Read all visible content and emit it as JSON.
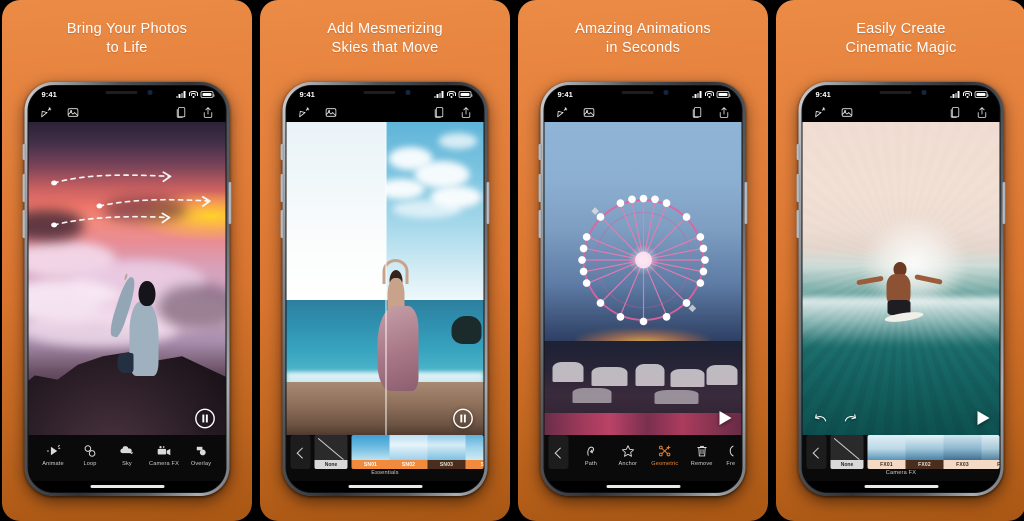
{
  "theme": {
    "background_top": "#eb8b45",
    "background_bottom": "#a95714",
    "accent": "#e8873a",
    "preset_label_bg": "#f08a3c",
    "selected_label_bg": "#4a2d1c"
  },
  "status_bar": {
    "time": "9:41",
    "icons": [
      "signal-icon",
      "wifi-icon",
      "battery-icon"
    ]
  },
  "app_toolbar": {
    "left_icons": [
      {
        "name": "magic-wand-icon"
      },
      {
        "name": "photo-library-icon"
      }
    ],
    "right_icons": [
      {
        "name": "layers-icon"
      },
      {
        "name": "share-icon"
      }
    ]
  },
  "panels": [
    {
      "id": "panel-1",
      "headline": {
        "line1": "Bring Your Photos",
        "line2": "to Life"
      },
      "canvas": {
        "photo_description": "person sitting on rock above pink sunset clouds",
        "overlay": "animation-path-arrows",
        "playback_icon": "pause-icon"
      },
      "bottom_bar_type": "tools",
      "tools": [
        {
          "label": "Animate",
          "icon": "animate-icon",
          "active": false
        },
        {
          "label": "Loop",
          "icon": "loop-icon",
          "active": false
        },
        {
          "label": "Sky",
          "icon": "sky-icon",
          "active": false
        },
        {
          "label": "Camera FX",
          "icon": "camera-fx-icon",
          "active": false
        },
        {
          "label": "Overlay",
          "icon": "overlay-icon",
          "active": false
        }
      ]
    },
    {
      "id": "panel-2",
      "headline": {
        "line1": "Add Mesmerizing",
        "line2": "Skies that Move"
      },
      "canvas": {
        "photo_description": "woman on coastal rock, before/after sky split",
        "overlay": "split-compare-divider",
        "playback_icon": "pause-icon"
      },
      "bottom_bar_type": "presets",
      "presets": {
        "back_icon": "chevron-left-icon",
        "none_label": "None",
        "category": "Essentials",
        "items": [
          {
            "label": "SN01",
            "selected": false
          },
          {
            "label": "SN02",
            "selected": false
          },
          {
            "label": "SN03",
            "selected": true
          },
          {
            "label": "SN",
            "selected": false
          }
        ]
      }
    },
    {
      "id": "panel-3",
      "headline": {
        "line1": "Amazing Animations",
        "line2": "in Seconds"
      },
      "canvas": {
        "photo_description": "pink lit ferris wheel at dusk over marina",
        "overlay": "animation-anchor-points",
        "playback_icon": "play-icon"
      },
      "bottom_bar_type": "tools",
      "tools": [
        {
          "label": "Path",
          "icon": "path-icon",
          "active": false
        },
        {
          "label": "Anchor",
          "icon": "anchor-star-icon",
          "active": false
        },
        {
          "label": "Geometric",
          "icon": "geometric-icon",
          "active": true
        },
        {
          "label": "Remove",
          "icon": "trash-icon",
          "active": false
        },
        {
          "label": "Fre",
          "icon": "freeze-icon",
          "active": false
        }
      ],
      "back_icon": "chevron-left-icon"
    },
    {
      "id": "panel-4",
      "headline": {
        "line1": "Easily Create",
        "line2": "Cinematic Magic"
      },
      "canvas": {
        "photo_description": "surfer riding a wave with radial zoom blur",
        "overlay": "undo-redo-controls",
        "undo_icon": "undo-icon",
        "redo_icon": "redo-icon",
        "playback_icon": "play-icon"
      },
      "bottom_bar_type": "presets",
      "presets": {
        "back_icon": "chevron-left-icon",
        "none_label": "None",
        "category": "Camera FX",
        "items": [
          {
            "label": "FX01",
            "selected": false
          },
          {
            "label": "FX02",
            "selected": true
          },
          {
            "label": "FX03",
            "selected": false
          },
          {
            "label": "FX",
            "selected": false
          }
        ]
      }
    }
  ]
}
